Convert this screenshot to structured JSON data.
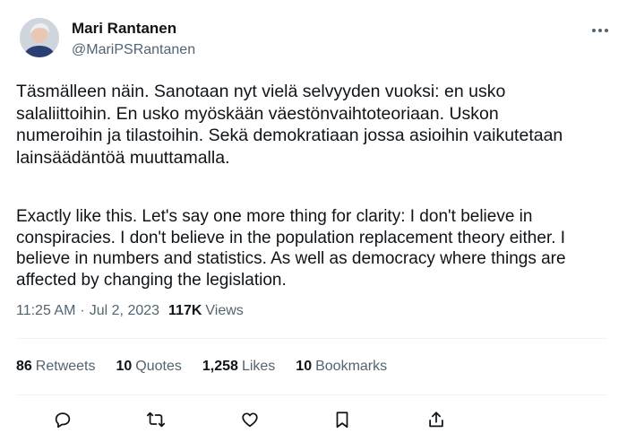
{
  "author": {
    "display_name": "Mari Rantanen",
    "handle": "@MariPSRantanen"
  },
  "tweet": {
    "text_fi": "Täsmälleen näin. Sanotaan nyt vielä selvyyden vuoksi: en usko salaliittoihin. En usko myöskään väestönvaihtoteoriaan. Uskon numeroihin ja tilastoihin. Sekä demokratiaan jossa asioihin vaikutetaan lainsäädäntöä muuttamalla.",
    "text_en": "Exactly like this. Let's say one more thing for clarity: I don't believe in conspiracies. I don't believe in the population replacement theory either. I believe in numbers and statistics. As well as democracy where things are affected by changing the legislation."
  },
  "meta": {
    "time": "11:25 AM",
    "separator": "·",
    "date": "Jul 2, 2023",
    "views_count": "117K",
    "views_label": "Views"
  },
  "stats": [
    {
      "count": "86",
      "label": "Retweets"
    },
    {
      "count": "10",
      "label": "Quotes"
    },
    {
      "count": "1,258",
      "label": "Likes"
    },
    {
      "count": "10",
      "label": "Bookmarks"
    }
  ],
  "actions": {
    "reply": "reply-icon",
    "retweet": "retweet-icon",
    "like": "heart-icon",
    "bookmark": "bookmark-icon",
    "share": "share-icon"
  },
  "colors": {
    "text_primary": "#0f1419",
    "text_secondary": "#536471",
    "divider": "#eff3f4"
  }
}
